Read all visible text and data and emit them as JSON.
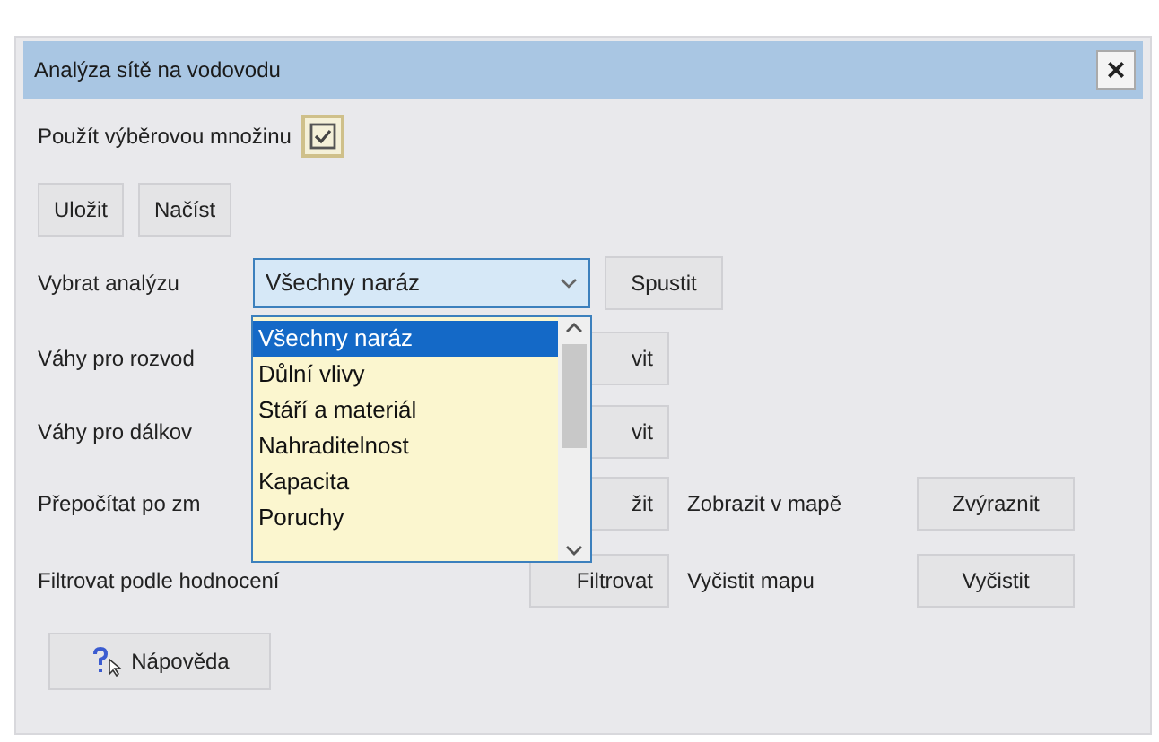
{
  "window": {
    "title": "Analýza sítě na vodovodu",
    "close": "×"
  },
  "use_selection": {
    "label": "Použít výběrovou množinu",
    "checked": true
  },
  "file_buttons": [
    "Uložit",
    "Načíst"
  ],
  "analysis": {
    "label": "Vybrat analýzu",
    "value": "Všechny naráz",
    "run_button": "Spustit",
    "dropdown": {
      "expanded": true,
      "options": [
        {
          "label": "Všechny naráz",
          "selected": true
        },
        {
          "label": "Důlní vlivy",
          "selected": false
        },
        {
          "label": "Stáří a materiál",
          "selected": false
        },
        {
          "label": "Nahraditelnost",
          "selected": false
        },
        {
          "label": "Kapacita",
          "selected": false
        },
        {
          "label": "Poruchy",
          "selected": false
        }
      ]
    }
  },
  "rows": [
    {
      "label": "Váhy pro rozvod",
      "button": "vit"
    },
    {
      "label": "Váhy pro dálkov",
      "button": "vit"
    },
    {
      "label": "Přepočítat po zm",
      "button": "žit",
      "text": "Zobrazit v mapě",
      "button_2": "Zvýraznit"
    },
    {
      "label": "Filtrovat podle hodnocení",
      "button": "Filtrovat",
      "text": "Vyčistit mapu",
      "button_2": "Vyčistit"
    }
  ],
  "help_button": "Nápověda"
}
